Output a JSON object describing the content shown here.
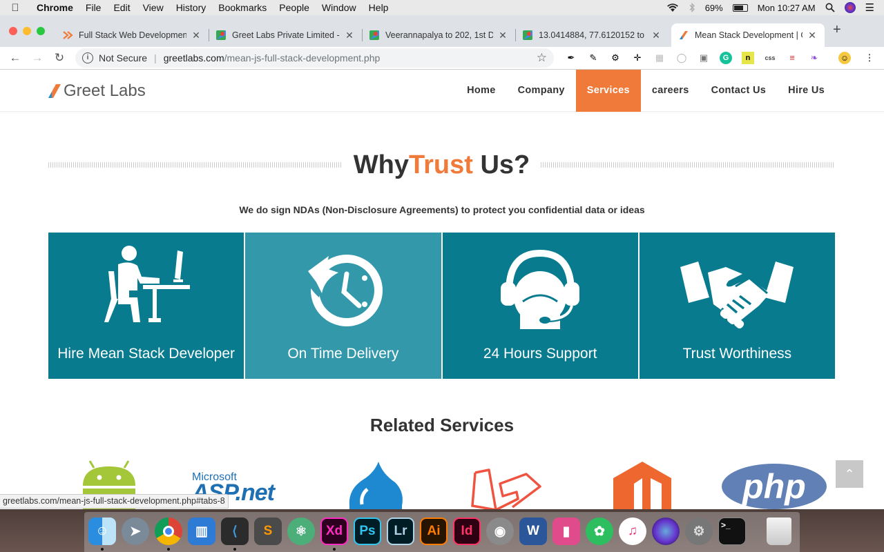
{
  "menubar": {
    "app": "Chrome",
    "items": [
      "File",
      "Edit",
      "View",
      "History",
      "Bookmarks",
      "People",
      "Window",
      "Help"
    ],
    "battery": "69%",
    "clock": "Mon 10:27 AM"
  },
  "tabs": [
    {
      "title": "Full Stack Web Developmen",
      "active": false
    },
    {
      "title": "Greet Labs Private Limited -",
      "active": false
    },
    {
      "title": "Veerannapalya to 202, 1st D",
      "active": false
    },
    {
      "title": "13.0414884, 77.6120152 to",
      "active": false
    },
    {
      "title": "Mean Stack Development | G",
      "active": true
    }
  ],
  "omnibox": {
    "security": "Not Secure",
    "domain": "greetlabs.com",
    "path": "/mean-js-full-stack-development.php"
  },
  "site": {
    "logo": "Greet Labs",
    "nav": [
      "Home",
      "Company",
      "Services",
      "careers",
      "Contact Us",
      "Hire Us"
    ],
    "active_nav": "Services",
    "trust_title_1": "Why",
    "trust_title_2": "Trust",
    "trust_title_3": " Us?",
    "nda": "We do sign NDAs (Non-Disclosure Agreements) to protect you confidential data or ideas",
    "boxes": [
      {
        "label": "Hire Mean Stack Developer",
        "icon": "developer-desk-icon"
      },
      {
        "label": "On Time Delivery",
        "icon": "clock-icon"
      },
      {
        "label": "24 Hours Support",
        "icon": "headset-icon"
      },
      {
        "label": "Trust Worthiness",
        "icon": "handshake-icon"
      }
    ],
    "related_title": "Related Services",
    "tech_logos": [
      "android-logo",
      "asp-net-logo",
      "drupal-logo",
      "laravel-logo",
      "magento-logo",
      "php-logo"
    ],
    "asp_text_1": "Microsoft",
    "asp_text_2": "ASP.net",
    "php_text": "php"
  },
  "status_url": "greetlabs.com/mean-js-full-stack-development.php#tabs-8",
  "dock": [
    "Finder",
    "Launchpad",
    "Chrome",
    "Keynote",
    "VS Code",
    "Sublime Text",
    "Atom",
    "Adobe XD",
    "Photoshop",
    "Lightroom",
    "Illustrator",
    "InDesign",
    "Koala",
    "Word",
    "CleanMyMac",
    "Evernote",
    "iTunes",
    "Siri",
    "System Preferences",
    "Terminal",
    "Trash"
  ],
  "dock_labels": {
    "xd": "Xd",
    "ps": "Ps",
    "lr": "Lr",
    "ai": "Ai",
    "id": "Id",
    "w": "W",
    "term": ">_"
  },
  "colors": {
    "accent": "#f07a3a",
    "teal": "#087b8f",
    "teal_light": "#3399aa"
  }
}
